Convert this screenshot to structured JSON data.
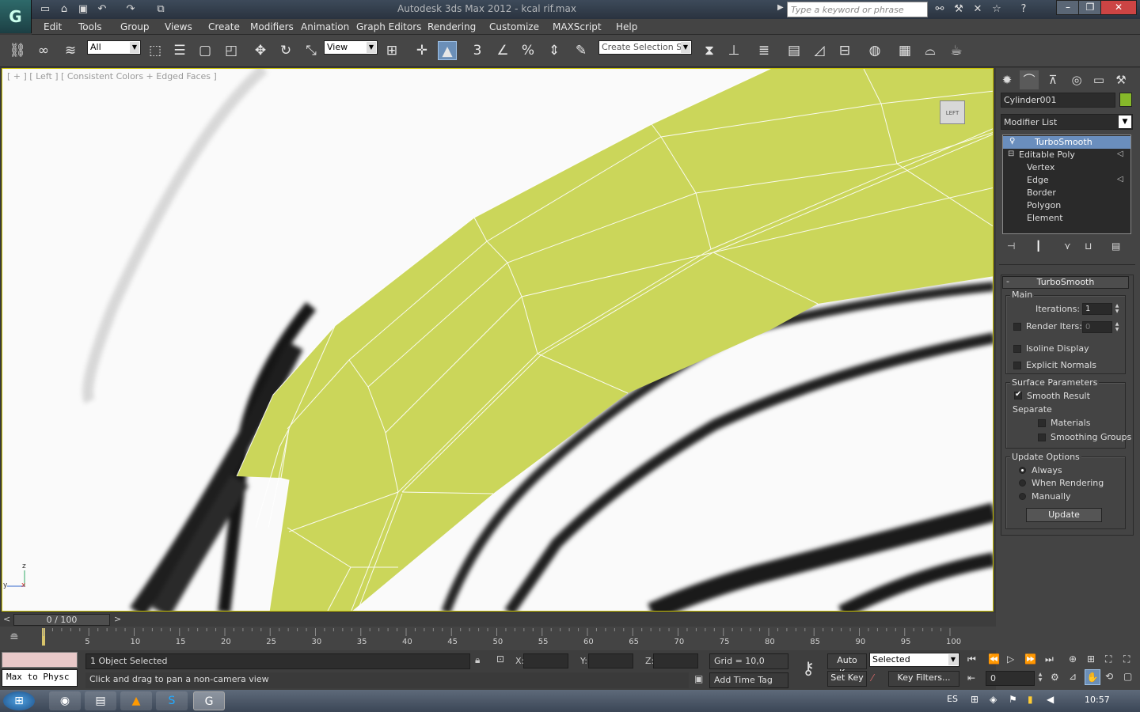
{
  "app": {
    "title": "Autodesk 3ds Max 2012  - kcal rif.max",
    "search_placeholder": "Type a keyword or phrase"
  },
  "menu": [
    "Edit",
    "Tools",
    "Group",
    "Views",
    "Create",
    "Modifiers",
    "Animation",
    "Graph Editors",
    "Rendering",
    "Customize",
    "MAXScript",
    "Help"
  ],
  "toolbar": {
    "selection_filter": "All",
    "ref_coord": "View",
    "named_selection": "Create Selection Se",
    "snap_label": "3"
  },
  "viewport": {
    "label": "[ + ] [ Left ] [ Consistent Colors + Edged Faces ]",
    "viewcube_label": "LEFT",
    "axis_z": "z",
    "axis_y": "y",
    "axis_x": "x",
    "mesh_color": "#cbd65a"
  },
  "command_panel": {
    "object_name": "Cylinder001",
    "object_color": "#86b82a",
    "modifier_list": "Modifier List",
    "stack": [
      "TurboSmooth",
      "Editable Poly",
      "Vertex",
      "Edge",
      "Border",
      "Polygon",
      "Element"
    ],
    "rollout_title": "TurboSmooth",
    "main": {
      "label": "Main",
      "iterations_label": "Iterations:",
      "iterations": "1",
      "render_iters_label": "Render Iters:",
      "render_iters": "0",
      "isoline": "Isoline Display",
      "explicit": "Explicit Normals"
    },
    "surface": {
      "label": "Surface Parameters",
      "smooth_result": "Smooth Result",
      "separate": "Separate",
      "materials": "Materials",
      "smoothing_groups": "Smoothing Groups"
    },
    "update": {
      "label": "Update Options",
      "always": "Always",
      "when_rendering": "When Rendering",
      "manually": "Manually",
      "button": "Update"
    }
  },
  "timeline": {
    "frame": "0 / 100",
    "ticks": [
      "5",
      "10",
      "15",
      "20",
      "25",
      "30",
      "35",
      "40",
      "45",
      "50",
      "55",
      "60",
      "65",
      "70",
      "75",
      "80",
      "85",
      "90",
      "95",
      "100"
    ]
  },
  "status": {
    "listener": "Max to Physc",
    "selected": "1 Object Selected",
    "prompt": "Click and drag to pan a non-camera view",
    "x_label": "X:",
    "y_label": "Y:",
    "z_label": "Z:",
    "grid": "Grid = 10,0",
    "add_time_tag": "Add Time Tag",
    "auto_key": "Auto Key",
    "set_key": "Set Key",
    "key_mode": "Selected",
    "key_filters": "Key Filters...",
    "current_frame": "0"
  },
  "taskbar": {
    "lang": "ES",
    "time": "10:57"
  }
}
